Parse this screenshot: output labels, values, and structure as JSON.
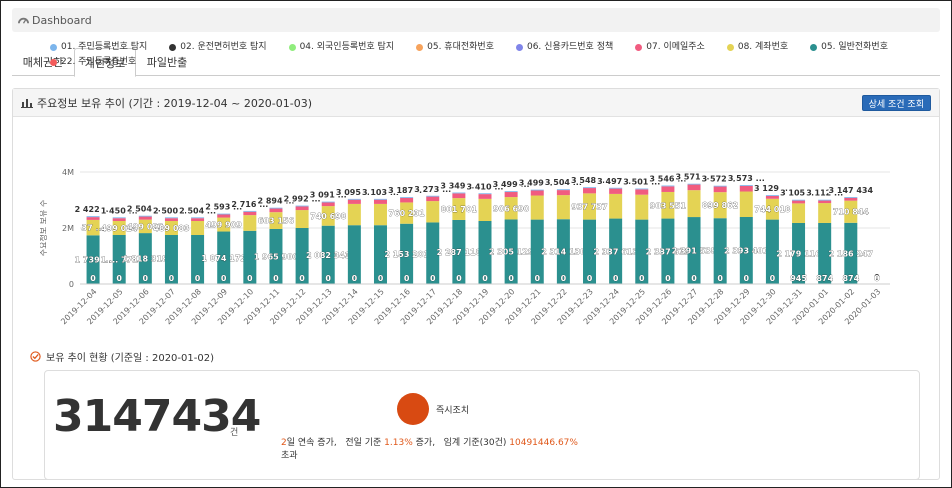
{
  "topbar": {
    "title": "Dashboard",
    "icon": "dashboard-icon"
  },
  "tabs": [
    {
      "label": "매체권한",
      "active": false
    },
    {
      "label": "개인정보",
      "active": true
    },
    {
      "label": "파일반출",
      "active": false
    }
  ],
  "panel": {
    "title": "주요정보 보유 추이 (기간 : 2019-12-04 ~ 2020-01-03)",
    "detail_button": "상세 조건 조회"
  },
  "legend": [
    {
      "label": "01. 주민등록번호 탐지",
      "color": "#7cb5ec"
    },
    {
      "label": "02. 운전면허번호 탐지",
      "color": "#333333"
    },
    {
      "label": "04. 외국인등록번호 탐지",
      "color": "#90ed7d"
    },
    {
      "label": "05. 휴대전화번호",
      "color": "#f7a35c"
    },
    {
      "label": "06. 신용카드번호 정책",
      "color": "#8085e9"
    },
    {
      "label": "07. 이메일주소",
      "color": "#f15c80"
    },
    {
      "label": "08. 계좌번호",
      "color": "#e4d354"
    },
    {
      "label": "05. 일반전화번호",
      "color": "#2b908f"
    },
    {
      "label": "22. 주민등록증번호",
      "color": "#f45b5b"
    }
  ],
  "chart_data": {
    "type": "bar",
    "stacked": true,
    "ylabel": "주요정보 보유 수",
    "yticks": [
      "0",
      "2M",
      "4M"
    ],
    "ylim": [
      0,
      4000000
    ],
    "categories": [
      "2019-12-04",
      "2019-12-05",
      "2019-12-06",
      "2019-12-07",
      "2019-12-08",
      "2019-12-09",
      "2019-12-10",
      "2019-12-11",
      "2019-12-12",
      "2019-12-13",
      "2019-12-14",
      "2019-12-15",
      "2019-12-16",
      "2019-12-17",
      "2019-12-18",
      "2019-12-19",
      "2019-12-20",
      "2019-12-21",
      "2019-12-22",
      "2019-12-23",
      "2019-12-24",
      "2019-12-25",
      "2019-12-26",
      "2019-12-27",
      "2019-12-28",
      "2019-12-29",
      "2019-12-30",
      "2019-12-31",
      "2020-01-01",
      "2020-01-02",
      "2020-01-03"
    ],
    "series": [
      {
        "name": "05. 일반전화번호",
        "color": "#2b908f",
        "values": [
          1739000,
          1750000,
          1818000,
          1750000,
          1750000,
          1874000,
          1900000,
          1965000,
          2000000,
          2082000,
          2100000,
          2100000,
          2153000,
          2200000,
          2287000,
          2250000,
          2305000,
          2300000,
          2314000,
          2300000,
          2337000,
          2300000,
          2337000,
          2391000,
          2350000,
          2393000,
          2300000,
          2179000,
          2180000,
          2186000,
          0
        ],
        "labels": [
          "1 739 ...",
          "1 ... 771",
          "1 818 318",
          "",
          "",
          "1 874 172",
          "",
          "1 965 900",
          "",
          "2 082 343",
          "",
          "",
          "2 153 201",
          "",
          "2 287 118",
          "",
          "2 305 129",
          "",
          "2 314 130",
          "",
          "2 337 613",
          "",
          "2 337 613",
          "2 391 538",
          "",
          "2 393 401",
          "",
          "2 179 116",
          "",
          "2 186 247",
          ""
        ]
      },
      {
        "name": "08. 계좌번호",
        "color": "#e4d354",
        "values": [
          550000,
          500000,
          480000,
          500000,
          500000,
          499000,
          560000,
          600000,
          640000,
          700000,
          760000,
          760000,
          760000,
          761000,
          780000,
          790000,
          800000,
          860000,
          860000,
          937000,
          880000,
          890000,
          950000,
          960000,
          930000,
          910000,
          744000,
          700000,
          710000,
          790000,
          0
        ],
        "labels": [
          "37 ...",
          "499 024",
          "499 083",
          "489 083",
          "",
          "499 909",
          "",
          "603 156",
          "",
          "740 698",
          "",
          "",
          "760 231",
          "",
          "801 701",
          "",
          "906 690",
          "",
          "",
          "937 737",
          "",
          "",
          "903 551",
          "",
          "899 862",
          "",
          "744 018",
          "",
          "",
          "710 844",
          ""
        ]
      },
      {
        "name": "07. 이메일주소",
        "color": "#f15c80",
        "values": [
          100000,
          100000,
          110000,
          100000,
          100000,
          110000,
          120000,
          130000,
          130000,
          130000,
          150000,
          150000,
          160000,
          160000,
          170000,
          170000,
          180000,
          180000,
          180000,
          190000,
          190000,
          190000,
          200000,
          200000,
          200000,
          200000,
          100000,
          100000,
          90000,
          100000,
          0
        ]
      },
      {
        "name": "01. 주민등록번호 탐지",
        "color": "#7cb5ec",
        "values": [
          33000,
          30000,
          30000,
          30000,
          30000,
          30000,
          30000,
          30000,
          30000,
          30000,
          30000,
          30000,
          30000,
          30000,
          30000,
          30000,
          30000,
          30000,
          30000,
          30000,
          30000,
          30000,
          30000,
          30000,
          30000,
          30000,
          30000,
          30000,
          30000,
          30000,
          0
        ]
      }
    ],
    "zero_labels": [
      "0",
      "0",
      "0",
      "0",
      "0",
      "0",
      "0",
      "0",
      "0",
      "0",
      "0",
      "0",
      "0",
      "0",
      "0",
      "0",
      "0",
      "0",
      "0",
      "0",
      "0",
      "0",
      "0",
      "0",
      "0",
      "0",
      "0",
      "945",
      "874",
      "874",
      "0"
    ],
    "total_labels": [
      "2 422 ...",
      "1 450 ...",
      "2 504 ...",
      "2 500 ...",
      "2 504 ...",
      "2 593 ...",
      "2 716 ...",
      "2 894 ...",
      "2 992 ...",
      "3 091 ...",
      "3 095 ...",
      "3 103 ...",
      "3 187 ...",
      "3 273 ...",
      "3 349 ...",
      "3 410 ...",
      "3 499 ...",
      "3 499 ...",
      "3 504 ...",
      "3 548 ...",
      "3 497 ...",
      "3 501 ...",
      "3 546 ...",
      "3 571 ...",
      "3 572 ...",
      "3 573 ...",
      "3 129 ...",
      "3 105 ...",
      "3 112 ...",
      "3 147 434",
      "0"
    ]
  },
  "section": {
    "title": "보유 추이 현황 (기준일 : 2020-01-02)"
  },
  "summary": {
    "count": "3147434",
    "unit": "건",
    "status_label": "즉시조치",
    "status_color": "#d84a12",
    "desc_consecutive_num": "2",
    "desc_consecutive_text": "일 연속 증가,",
    "desc_prev_text": "전일 기준",
    "desc_prev_pct": "1.13%",
    "desc_prev_suffix": "증가,",
    "desc_threshold_text": "임계 기준(30건)",
    "desc_threshold_pct": "10491446.67%",
    "desc_exceed": "초과"
  }
}
